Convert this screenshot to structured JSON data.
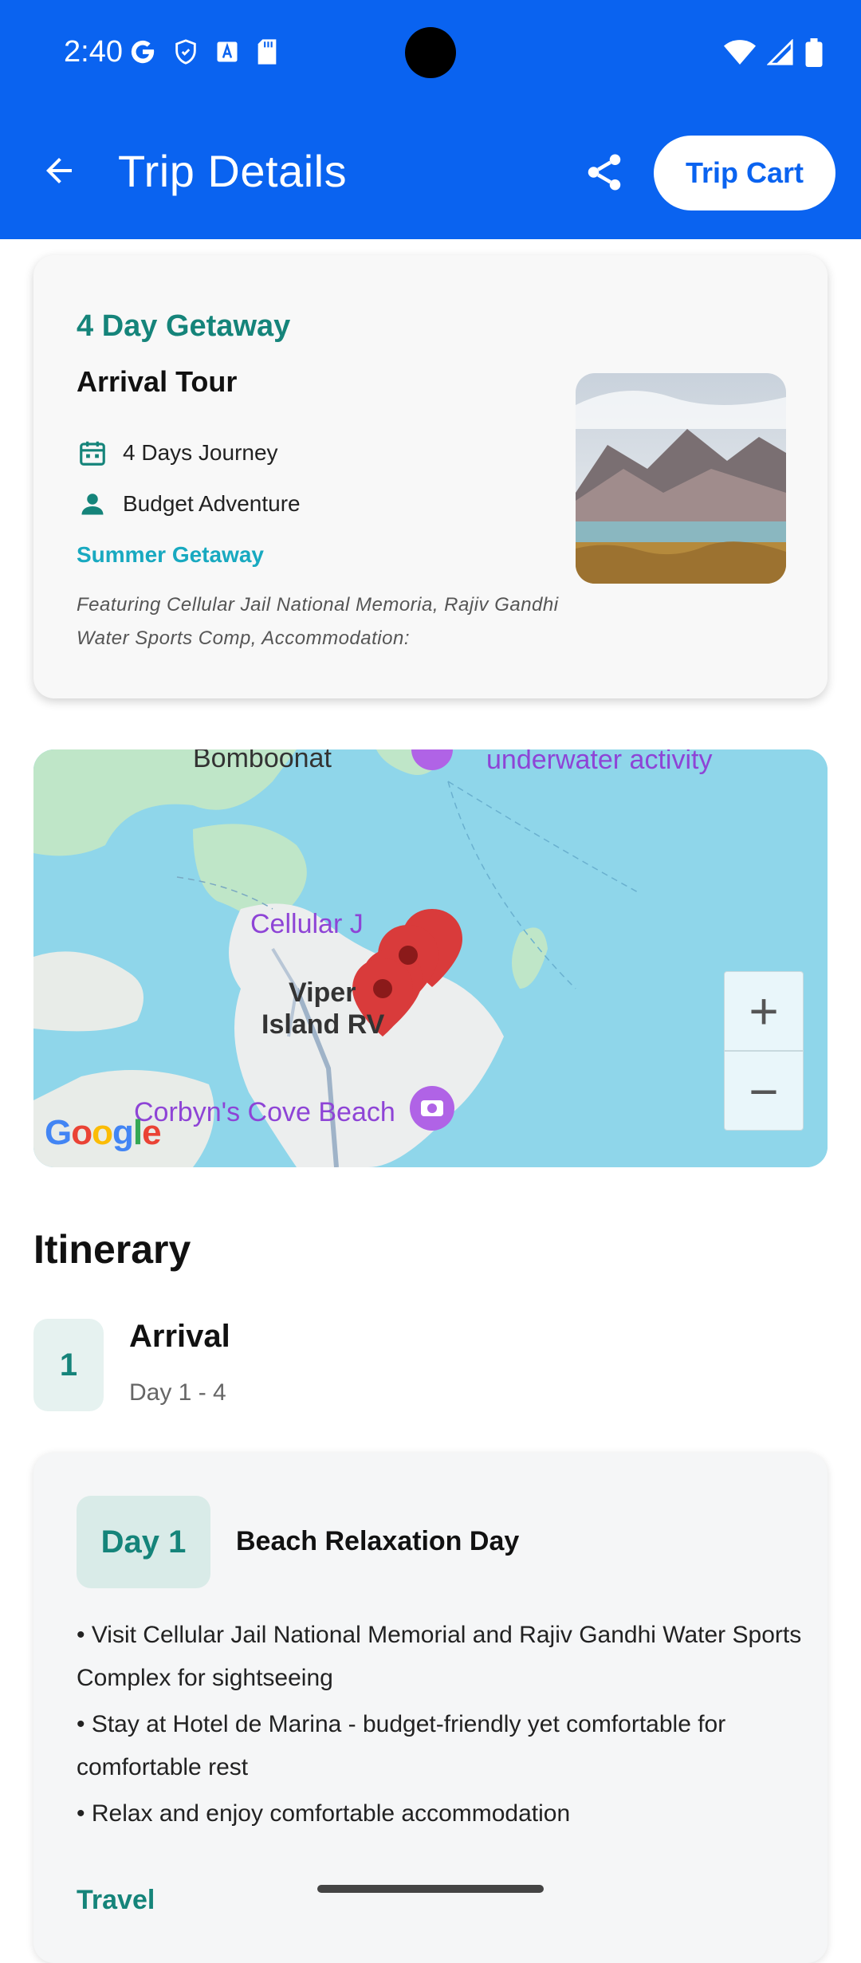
{
  "status": {
    "time": "2:40",
    "left_icons": [
      "google-icon",
      "shield-icon",
      "text-a-icon",
      "sd-card-icon"
    ],
    "right_icons": [
      "wifi-icon",
      "signal-icon",
      "battery-icon"
    ]
  },
  "appbar": {
    "title": "Trip Details",
    "cart_label": "Trip Cart",
    "accent": "#0a63f0"
  },
  "trip": {
    "kicker": "4 Day Getaway",
    "name": "Arrival Tour",
    "duration": "4 Days Journey",
    "type": "Budget Adventure",
    "season": "Summer Getaway",
    "description": "Featuring Cellular Jail National Memoria, Rajiv Gandhi Water Sports Comp, Accommodation:"
  },
  "map": {
    "labels": {
      "top_left": "Bomboonat",
      "top_right": "underwater activity",
      "poi1": "Cellular J",
      "poi2a": "Viper",
      "poi2b": "Island RV",
      "poi3": "Corbyn's Cove Beach"
    },
    "zoom_in": "+",
    "zoom_out": "−",
    "attribution": "Google"
  },
  "itinerary": {
    "heading": "Itinerary",
    "number": "1",
    "title": "Arrival",
    "range": "Day 1 - 4"
  },
  "day": {
    "chip": "Day 1",
    "name": "Beach Relaxation Day",
    "bullets": [
      "• Visit Cellular Jail National Memorial and Rajiv Gandhi Water Sports Complex for sightseeing",
      "• Stay at Hotel de Marina - budget-friendly yet comfortable for comfortable rest",
      "• Relax and enjoy comfortable accommodation"
    ],
    "travel_heading": "Travel"
  }
}
